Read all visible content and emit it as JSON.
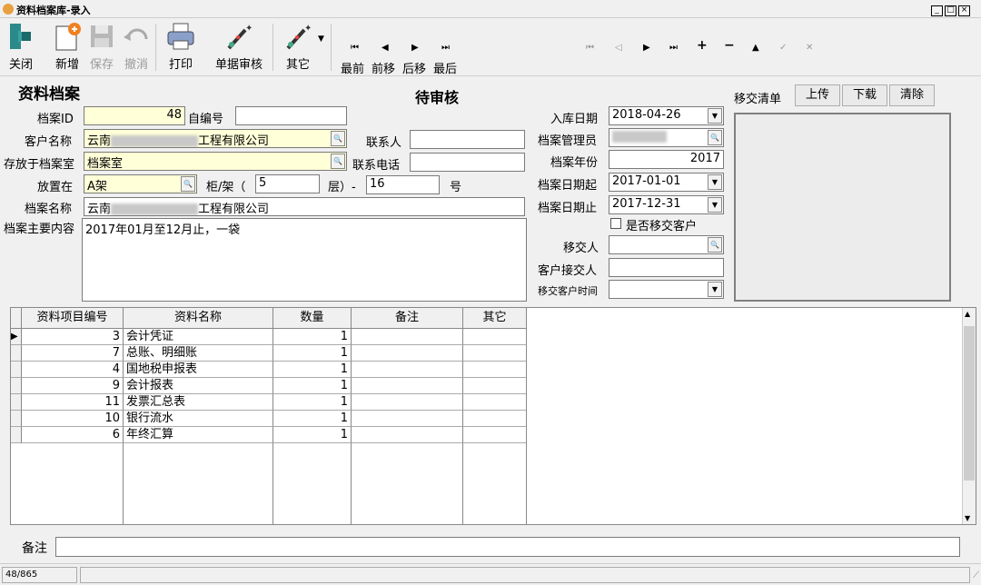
{
  "window": {
    "title": "资料档案库-录入"
  },
  "toolbar": {
    "close": "关闭",
    "new": "新增",
    "save": "保存",
    "undo": "撤消",
    "print": "打印",
    "audit": "单据审核",
    "other": "其它",
    "first": "最前",
    "prev": "前移",
    "next": "后移",
    "last": "最后"
  },
  "form": {
    "heading": "资料档案",
    "status": "待审核",
    "archive_id_label": "档案ID",
    "archive_id": "48",
    "self_no_label": "自编号",
    "self_no": "",
    "customer_label": "客户名称",
    "customer_prefix": "云南",
    "customer_suffix": "工程有限公司",
    "contact_label": "联系人",
    "contact": "",
    "room_label": "存放于档案室",
    "room": "档案室",
    "phone_label": "联系电话",
    "phone": "",
    "place_label": "放置在",
    "place": "A架",
    "cabinet_label": "柜/架（",
    "cabinet": "5",
    "layer_label": "层）-",
    "layer": "16",
    "num_label": "号",
    "name_label": "档案名称",
    "name_prefix": "云南",
    "name_suffix": "工程有限公司",
    "content_label": "档案主要内容",
    "content": "2017年01月至12月止，一袋",
    "in_date_label": "入库日期",
    "in_date": "2018-04-26",
    "admin_label": "档案管理员",
    "admin": "",
    "year_label": "档案年份",
    "year": "2017",
    "start_label": "档案日期起",
    "start": "2017-01-01",
    "end_label": "档案日期止",
    "end": "2017-12-31",
    "transfer_check": "是否移交客户",
    "transferor_label": "移交人",
    "transferor": "",
    "receiver_label": "客户接交人",
    "receiver": "",
    "transfer_time_label": "移交客户时间",
    "transfer_time": "",
    "transfer_list_label": "移交清单",
    "upload": "上传",
    "download": "下载",
    "clear": "清除"
  },
  "grid": {
    "headers": [
      "资料项目编号",
      "资料名称",
      "数量",
      "备注",
      "其它"
    ],
    "rows": [
      {
        "id": "3",
        "name": "会计凭证",
        "qty": "1"
      },
      {
        "id": "7",
        "name": "总账、明细账",
        "qty": "1"
      },
      {
        "id": "4",
        "name": "国地税申报表",
        "qty": "1"
      },
      {
        "id": "9",
        "name": "会计报表",
        "qty": "1"
      },
      {
        "id": "11",
        "name": "发票汇总表",
        "qty": "1"
      },
      {
        "id": "10",
        "name": "银行流水",
        "qty": "1"
      },
      {
        "id": "6",
        "name": "年终汇算",
        "qty": "1"
      }
    ]
  },
  "remark_label": "备注",
  "remark": "",
  "statusbar": {
    "record": "48/865"
  }
}
